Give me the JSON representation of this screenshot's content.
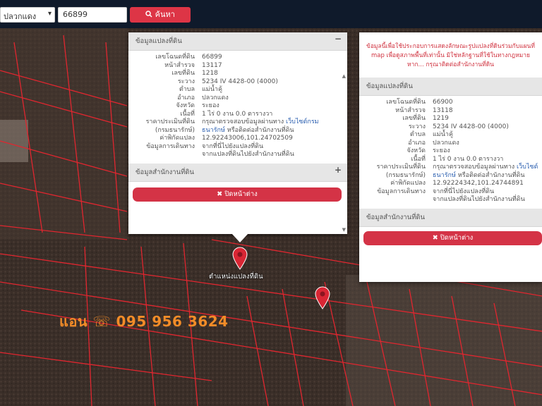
{
  "search": {
    "province_value": "ปลวกแดง",
    "parcel_value": "66899",
    "search_label": "ค้นหา"
  },
  "panel1": {
    "header": "ข้อมูลแปลงที่ดิน",
    "rows": [
      {
        "k": "เลขโฉนดที่ดิน",
        "v": "66899"
      },
      {
        "k": "หน้าสำรวจ",
        "v": "13117"
      },
      {
        "k": "เลขที่ดิน",
        "v": "1218"
      },
      {
        "k": "ระวาง",
        "v": "5234 IV 4428-00 (4000)"
      },
      {
        "k": "ตำบล",
        "v": "แม่น้ำคู้"
      },
      {
        "k": "อำเภอ",
        "v": "ปลวกแดง"
      },
      {
        "k": "จังหวัด",
        "v": "ระยอง"
      },
      {
        "k": "เนื้อที่",
        "v": "1 ไร่ 0 งาน 0.0 ตารางวา"
      }
    ],
    "price_k": "ราคาประเมินที่ดิน",
    "price_v1": "กรุณาตรวจสอบข้อมูลผ่านทาง",
    "price_link1": "เว็บไซต์กรม",
    "price_k2": "(กรมธนารักษ์)",
    "price_link2": "ธนารักษ์",
    "price_v2": "หรือติดต่อสำนักงานที่ดิน",
    "coord_k": "ค่าพิกัดแปลง",
    "coord_v": "12.92243006,101.24702509",
    "travel_k": "ข้อมูลการเดินทาง",
    "travel_v1": "จากที่นี่ไปยังแปลงที่ดิน",
    "travel_v2": "จากแปลงที่ดินไปยังสำนักงานที่ดิน",
    "office_header": "ข้อมูลสำนักงานที่ดิน",
    "close_label": "ปิดหน้าต่าง"
  },
  "panel2": {
    "notice": "ข้อมูลนี้เพื่อใช้ประกอบการแสดงลักษณะรูปแปลงที่ดินร่วมกับแผนที่ map เพื่อดูสภาพพื้นที่เท่านั้น มิใช่หลักฐานที่ใช้ในทางกฎหมาย หาก... กรุณาติดต่อสำนักงานที่ดิน",
    "header": "ข้อมูลแปลงที่ดิน",
    "rows": [
      {
        "k": "เลขโฉนดที่ดิน",
        "v": "66900"
      },
      {
        "k": "หน้าสำรวจ",
        "v": "13118"
      },
      {
        "k": "เลขที่ดิน",
        "v": "1219"
      },
      {
        "k": "ระวาง",
        "v": "5234 IV 4428-00 (4000)"
      },
      {
        "k": "ตำบล",
        "v": "แม่น้ำคู้"
      },
      {
        "k": "อำเภอ",
        "v": "ปลวกแดง"
      },
      {
        "k": "จังหวัด",
        "v": "ระยอง"
      },
      {
        "k": "เนื้อที่",
        "v": "1 ไร่ 0 งาน 0.0 ตารางวา"
      }
    ],
    "price_k": "ราคาประเมินที่ดิน",
    "price_v1": "กรุณาตรวจสอบข้อมูลผ่านทาง",
    "price_link1": "เว็บไซต์",
    "price_k2": "(กรมธนารักษ์)",
    "price_link2": "ธนารักษ์",
    "price_v2": "หรือติดต่อสำนักงานที่ดิน",
    "coord_k": "ค่าพิกัดแปลง",
    "coord_v": "12.92224342,101.24744891",
    "travel_k": "ข้อมูลการเดินทาง",
    "travel_v1": "จากที่นี่ไปยังแปลงที่ดิน",
    "travel_v2": "จากแปลงที่ดินไปยังสำนักงานที่ดิน",
    "office_header": "ข้อมูลสำนักงานที่ดิน",
    "close_label": "ปิดหน้าต่าง"
  },
  "map": {
    "pin_label": "ตำแหน่งแปลงที่ดิน",
    "contact_text": "แอน ☏ 095 956 3624",
    "colors": {
      "parcel_line": "#e0262f",
      "pin": "#d92634",
      "contact": "#f28c28"
    }
  }
}
